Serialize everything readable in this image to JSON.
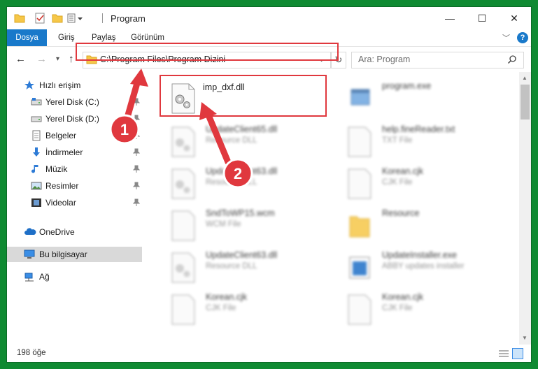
{
  "window": {
    "title": "Program",
    "controls": {
      "minimize": "—",
      "maximize": "☐",
      "close": "✕"
    }
  },
  "ribbon": {
    "tabs": [
      "Dosya",
      "Giriş",
      "Paylaş",
      "Görünüm"
    ],
    "accent": "#1979ca"
  },
  "navigation": {
    "address": "C:\\Program Files\\Program Dizini",
    "search_placeholder": "Ara: Program"
  },
  "sidebar": {
    "items": [
      {
        "label": "Hızlı erişim",
        "icon": "star-icon",
        "pinned": false
      },
      {
        "label": "Yerel Disk (C:)",
        "icon": "drive-icon",
        "pinned": true
      },
      {
        "label": "Yerel Disk (D:)",
        "icon": "drive-icon",
        "pinned": true
      },
      {
        "label": "Belgeler",
        "icon": "documents-icon",
        "pinned": true
      },
      {
        "label": "İndirmeler",
        "icon": "download-icon",
        "pinned": true
      },
      {
        "label": "Müzik",
        "icon": "music-icon",
        "pinned": true
      },
      {
        "label": "Resimler",
        "icon": "pictures-icon",
        "pinned": true
      },
      {
        "label": "Videolar",
        "icon": "video-icon",
        "pinned": true
      },
      {
        "label": "OneDrive",
        "icon": "cloud-icon",
        "pinned": false
      },
      {
        "label": "Bu bilgisayar",
        "icon": "computer-icon",
        "pinned": false,
        "selected": true
      },
      {
        "label": "Ağ",
        "icon": "network-icon",
        "pinned": false
      }
    ]
  },
  "files": [
    {
      "name": "imp_dxf.dll",
      "type": "",
      "icon": "dll-gear-icon",
      "highlighted": true
    },
    {
      "name": "program.exe",
      "type": "",
      "icon": "exe-icon"
    },
    {
      "name": "UpdateClient65.dll",
      "type": "Resource DLL",
      "icon": "dll-gear-icon"
    },
    {
      "name": "help.fineReader.txt",
      "type": "TXT File",
      "icon": "text-file-icon"
    },
    {
      "name": "UpdateClient63.dll",
      "type": "Resource DLL",
      "icon": "dll-gear-icon"
    },
    {
      "name": "Korean.cjk",
      "type": "CJK File",
      "icon": "blank-file-icon"
    },
    {
      "name": "SndToWP15.wcm",
      "type": "WCM File",
      "icon": "blank-file-icon"
    },
    {
      "name": "Resource",
      "type": "",
      "icon": "folder-icon"
    },
    {
      "name": "UpdateClient63.dll",
      "type": "Resource DLL",
      "icon": "dll-gear-icon"
    },
    {
      "name": "UpdateInstaller.exe",
      "type": "ABBY updates installer",
      "icon": "installer-icon"
    },
    {
      "name": "Korean.cjk",
      "type": "CJK File",
      "icon": "blank-file-icon"
    },
    {
      "name": "Korean.cjk",
      "type": "CJK File",
      "icon": "blank-file-icon"
    }
  ],
  "status": {
    "count": "198 öğe"
  },
  "annotations": {
    "step1": "1",
    "step2": "2",
    "color": "#e0383e"
  }
}
